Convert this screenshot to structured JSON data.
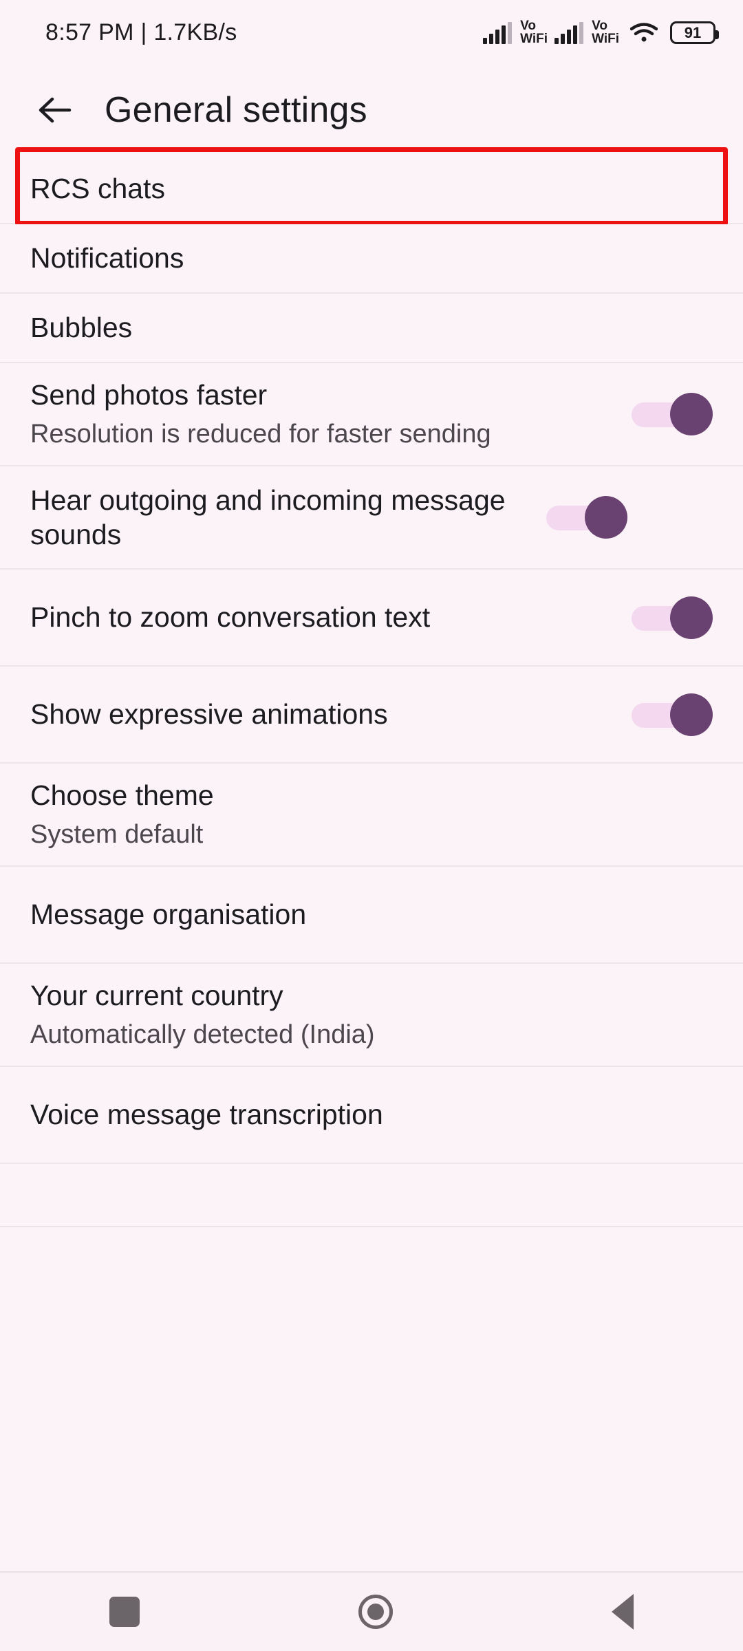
{
  "status_bar": {
    "time_and_speed": "8:57 PM | 1.7KB/s",
    "sim1_label": "Vo",
    "sim1_label2": "WiFi",
    "sim2_label": "Vo",
    "sim2_label2": "WiFi",
    "battery_percent": "91",
    "icons": [
      "signal-bars-icon",
      "volte-wifi-icon",
      "signal-bars-icon",
      "volte-wifi-icon",
      "wifi-icon",
      "battery-icon"
    ]
  },
  "app_bar": {
    "back_icon": "arrow-left-icon",
    "title": "General settings"
  },
  "highlight": {
    "color": "#EE1111",
    "target": "RCS chats"
  },
  "theme": {
    "background": "#FBF3F7",
    "toggle_on_thumb": "#6A4272",
    "toggle_on_track": "#F3D8F0",
    "divider": "#ECE4E8",
    "title_color": "#1C1B1F",
    "subtitle_color": "#4C464D"
  },
  "settings": [
    {
      "title": "RCS chats",
      "subtitle": "",
      "type": "nav",
      "highlighted": true
    },
    {
      "title": "Notifications",
      "subtitle": "",
      "type": "nav",
      "highlighted": false
    },
    {
      "title": "Bubbles",
      "subtitle": "",
      "type": "nav",
      "highlighted": false
    },
    {
      "title": "Send photos faster",
      "subtitle": "Resolution is reduced for faster sending",
      "type": "toggle",
      "toggle_on": true
    },
    {
      "title": "Hear outgoing and incoming message sounds",
      "subtitle": "",
      "type": "toggle",
      "toggle_on": true
    },
    {
      "title": "Pinch to zoom conversation text",
      "subtitle": "",
      "type": "toggle",
      "toggle_on": true
    },
    {
      "title": "Show expressive animations",
      "subtitle": "",
      "type": "toggle",
      "toggle_on": true
    },
    {
      "title": "Choose theme",
      "subtitle": "System default",
      "type": "nav",
      "highlighted": false
    },
    {
      "title": "Message organisation",
      "subtitle": "",
      "type": "nav",
      "highlighted": false
    },
    {
      "title": "Your current country",
      "subtitle": "Automatically detected (India)",
      "type": "nav",
      "highlighted": false
    },
    {
      "title": "Voice message transcription",
      "subtitle": "",
      "type": "nav",
      "highlighted": false
    }
  ],
  "nav_bar": {
    "recents_icon": "square-recents-icon",
    "home_icon": "circle-home-icon",
    "back_icon": "triangle-back-icon"
  }
}
